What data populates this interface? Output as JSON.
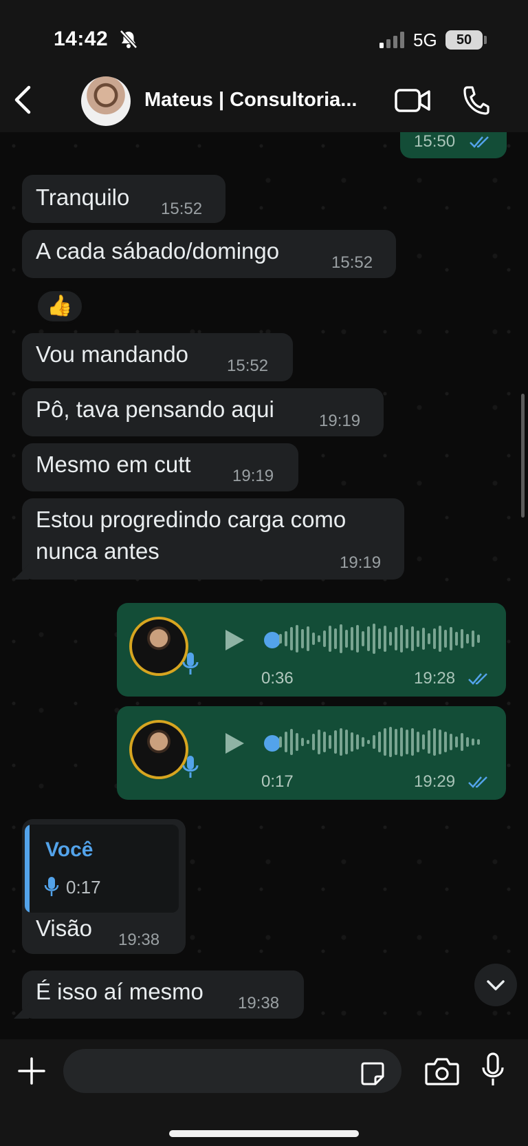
{
  "status_bar": {
    "time": "14:42",
    "network": "5G",
    "battery": "50",
    "icons": [
      "bell-muted-icon",
      "signal-icon",
      "battery-icon"
    ]
  },
  "header": {
    "contact_name": "Mateus | Consultoria...",
    "icons": [
      "chevron-left-icon",
      "video-camera-icon",
      "phone-icon"
    ]
  },
  "messages": [
    {
      "direction": "out",
      "text": "",
      "time": "15:50",
      "read": true
    },
    {
      "direction": "in",
      "text": "Tranquilo",
      "time": "15:52"
    },
    {
      "direction": "in",
      "text": "A cada sábado/domingo",
      "time": "15:52",
      "reaction": "👍"
    },
    {
      "direction": "in",
      "text": "Vou mandando",
      "time": "15:52"
    },
    {
      "direction": "in",
      "text": "Pô, tava pensando aqui",
      "time": "19:19"
    },
    {
      "direction": "in",
      "text": "Mesmo em cutt",
      "time": "19:19"
    },
    {
      "direction": "in",
      "lines": [
        "Estou progredindo carga como",
        "nunca antes"
      ],
      "time": "19:19"
    },
    {
      "direction": "out",
      "type": "voice",
      "duration": "0:36",
      "time": "19:28",
      "read": true
    },
    {
      "direction": "out",
      "type": "voice",
      "duration": "0:17",
      "time": "19:29",
      "read": true
    },
    {
      "direction": "in",
      "quote": {
        "author": "Você",
        "duration": "0:17"
      },
      "text": "Visão",
      "time": "19:38"
    },
    {
      "direction": "in",
      "text": "É isso aí mesmo",
      "time": "19:38"
    }
  ],
  "composer": {
    "icons": [
      "plus-icon",
      "sticker-icon",
      "camera-icon",
      "mic-icon"
    ]
  },
  "colors": {
    "incoming_bubble": "#1f2123",
    "outgoing_bubble": "#134d37",
    "read_ticks": "#53a3ea",
    "background": "#0b0b0b"
  }
}
